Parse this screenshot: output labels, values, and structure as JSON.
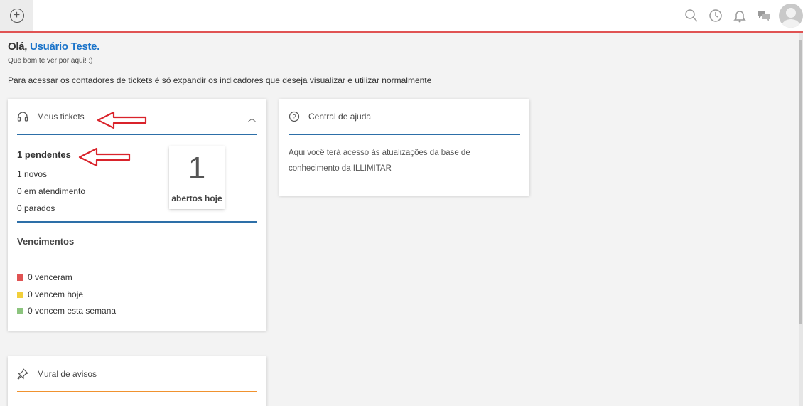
{
  "topbar": {
    "icons": [
      "add-icon",
      "search-icon",
      "history-icon",
      "bell-icon",
      "chat-icon",
      "avatar"
    ]
  },
  "greeting": {
    "hello": "Olá,",
    "user": "Usuário Teste.",
    "subtitle": "Que bom te ver por aqui! :)"
  },
  "intro": "Para acessar os contadores de tickets é só expandir os indicadores que deseja visualizar e utilizar normalmente",
  "tickets": {
    "title": "Meus tickets",
    "pending": "1 pendentes",
    "new": "1 novos",
    "in_progress": "0 em atendimento",
    "stopped": "0 parados",
    "opened_today_count": "1",
    "opened_today_label": "abertos hoje",
    "due_title": "Vencimentos",
    "due": [
      {
        "label": "0 venceram",
        "color": "#e05353"
      },
      {
        "label": "0 vencem hoje",
        "color": "#f2cf3b"
      },
      {
        "label": "0 vencem esta semana",
        "color": "#8cc47e"
      }
    ]
  },
  "help": {
    "title": "Central de ajuda",
    "text_line1": "Aqui você terá acesso às atualizações da base de",
    "text_line2": "conhecimento da ILLIMITAR"
  },
  "mural": {
    "title": "Mural de avisos"
  },
  "colors": {
    "accent": "#1a73c9",
    "topline": "#e05353",
    "underline": "#2d6fa8",
    "mural_underline": "#f0922f",
    "annotation": "#d9232b"
  }
}
